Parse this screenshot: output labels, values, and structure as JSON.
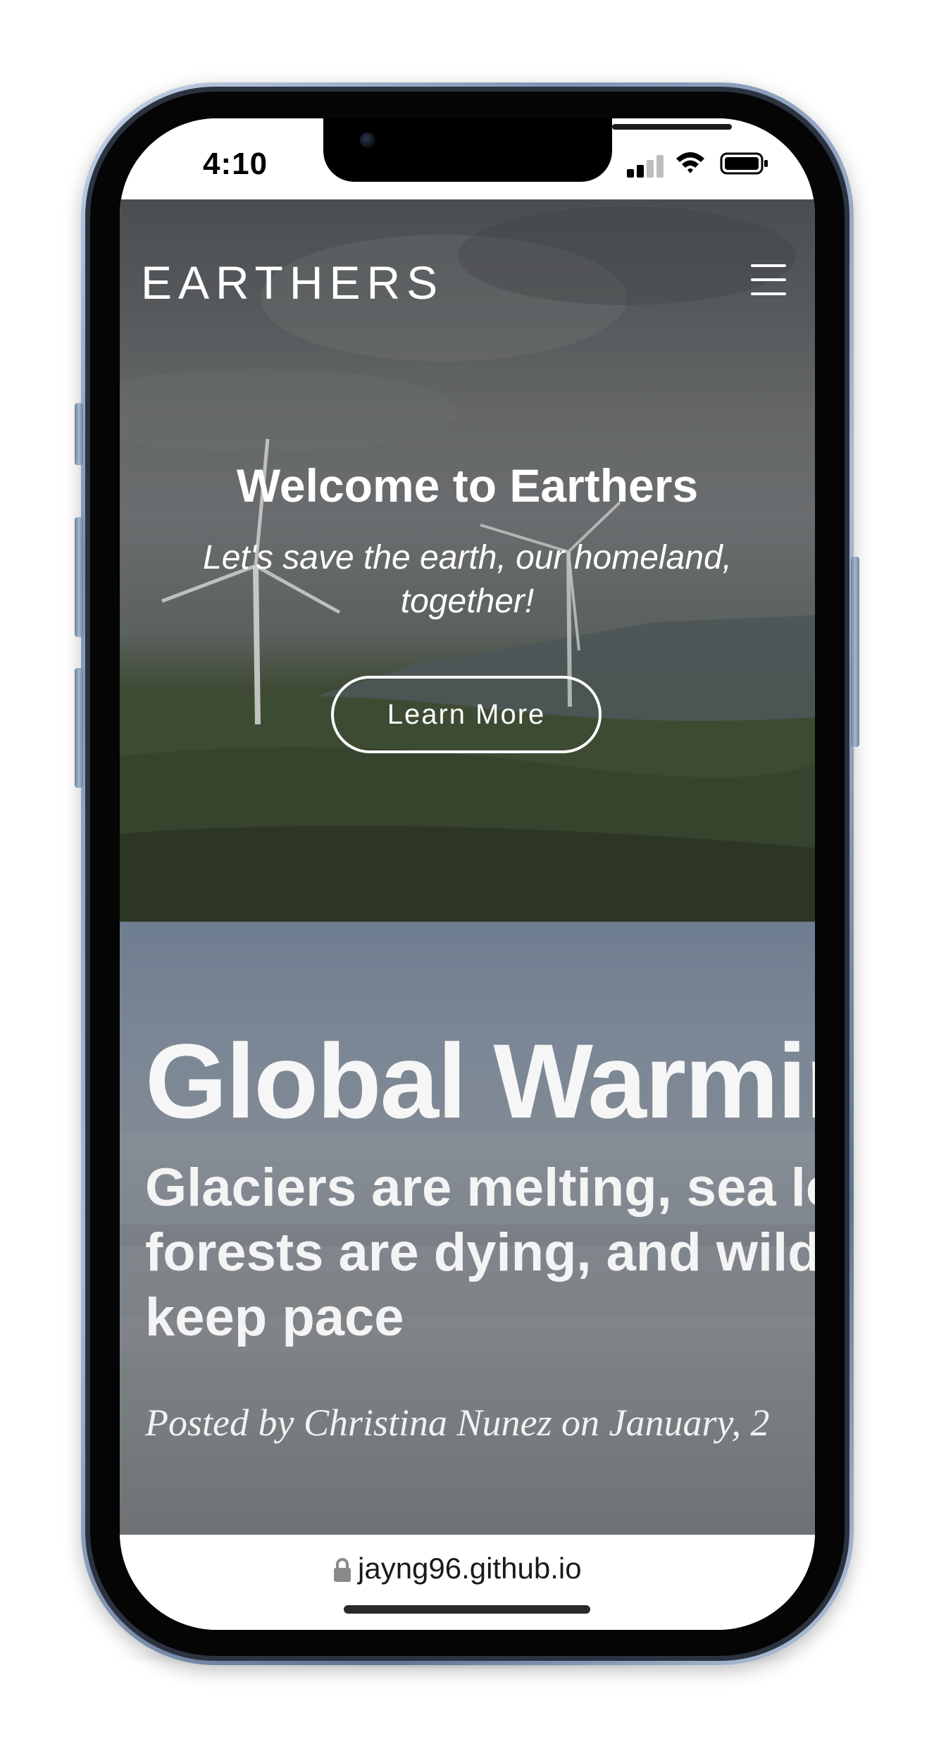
{
  "status_bar": {
    "time": "4:10"
  },
  "hero": {
    "brand": "EARTHERS",
    "title": "Welcome to Earthers",
    "subtitle": "Let's save the earth, our homeland, together!",
    "cta_label": "Learn More",
    "menu_icon": "hamburger-menu-icon"
  },
  "post": {
    "title": "Global Warmin",
    "subtitle": "Glaciers are melting, sea le\nforests are dying, and wildl\nkeep pace",
    "meta": "Posted by Christina Nunez on January, 2"
  },
  "browser": {
    "url": "jayng96.github.io",
    "lock_icon": "lock-icon"
  },
  "colors": {
    "hero_overlay": "#4b4e51",
    "post_bg": "#7b8796",
    "text": "#ffffff"
  }
}
